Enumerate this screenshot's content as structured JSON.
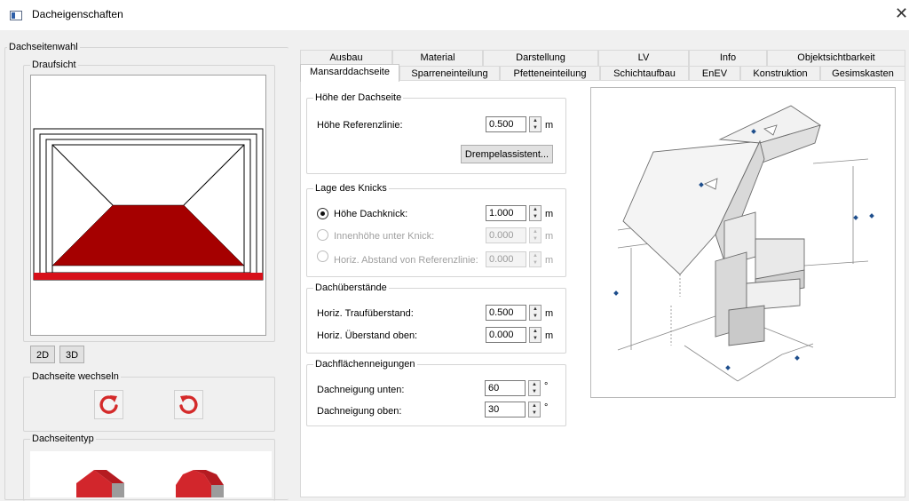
{
  "window": {
    "title": "Dacheigenschaften",
    "close_glyph": "✕"
  },
  "left": {
    "dachseitenwahl_label": "Dachseitenwahl",
    "draufsicht_label": "Draufsicht",
    "btn_2d": "2D",
    "btn_3d": "3D",
    "wechseln_label": "Dachseite wechseln",
    "rotate_cw_icon": "rotate-clockwise-icon",
    "rotate_ccw_icon": "rotate-counterclockwise-icon",
    "dachseitentyp_label": "Dachseitentyp"
  },
  "tabs_back": [
    "Ausbau",
    "Material",
    "Darstellung",
    "LV",
    "Info",
    "Objektsichtbarkeit"
  ],
  "tabs_front": [
    "Mansarddachseite",
    "Sparreneinteilung",
    "Pfetteneinteilung",
    "Schichtaufbau",
    "EnEV",
    "Konstruktion",
    "Gesimskasten"
  ],
  "active_tab": "Mansarddachseite",
  "hoehe": {
    "group_label": "Höhe der Dachseite",
    "ref_label": "Höhe Referenzlinie:",
    "ref_value": "0.500",
    "ref_unit": "m",
    "drempel_button": "Drempelassistent..."
  },
  "knick": {
    "group_label": "Lage des Knicks",
    "opt1_label": "Höhe Dachknick:",
    "opt1_value": "1.000",
    "opt1_unit": "m",
    "opt2_label": "Innenhöhe unter Knick:",
    "opt2_value": "0.000",
    "opt2_unit": "m",
    "opt3_label": "Horiz. Abstand von Referenzlinie:",
    "opt3_value": "0.000",
    "opt3_unit": "m",
    "selected": "Höhe Dachknick:"
  },
  "ueberstaende": {
    "group_label": "Dachüberstände",
    "trauf_label": "Horiz. Traufüberstand:",
    "trauf_value": "0.500",
    "trauf_unit": "m",
    "oben_label": "Horiz. Überstand oben:",
    "oben_value": "0.000",
    "oben_unit": "m"
  },
  "neigungen": {
    "group_label": "Dachflächenneigungen",
    "unten_label": "Dachneigung unten:",
    "unten_value": "60",
    "unten_unit": "°",
    "oben_label": "Dachneigung oben:",
    "oben_value": "30",
    "oben_unit": "°"
  },
  "colors": {
    "roof_red": "#a50000",
    "roof_red_bright": "#d7101a",
    "type_icon_red": "#d2262c",
    "rotate_icon_red": "#d42a2a",
    "marker_blue": "#1e4e8c"
  }
}
